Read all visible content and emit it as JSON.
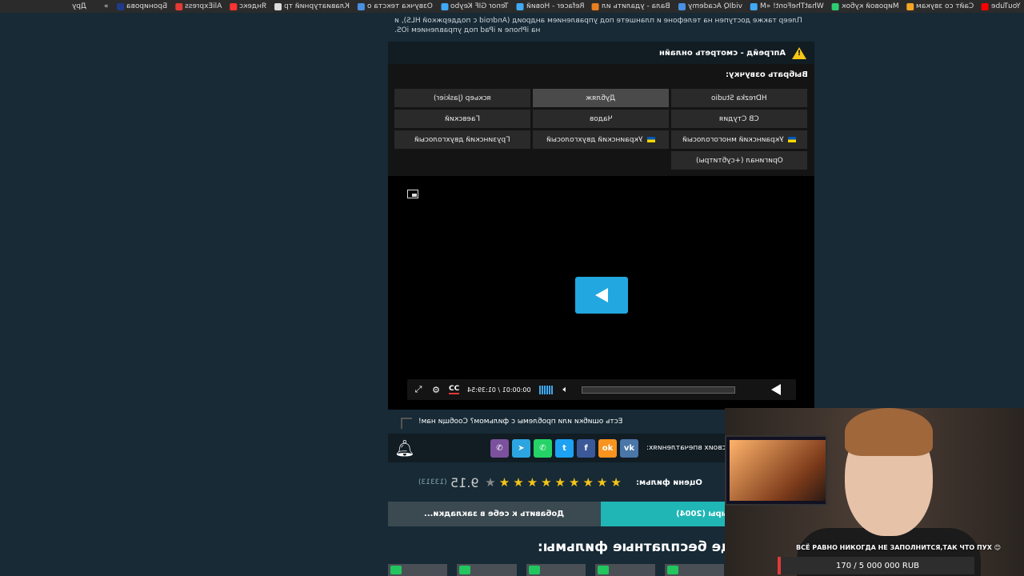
{
  "bookmarks": [
    {
      "label": "YouTube",
      "color": "#ff0000"
    },
    {
      "label": "Сайт со звукам",
      "color": "#f5a623"
    },
    {
      "label": "Мировой кубок",
      "color": "#2ecc71"
    },
    {
      "label": "WhatTheFont! «M",
      "color": "#3fa9f5"
    },
    {
      "label": "vidIQ Academy",
      "color": "#4a90e2"
    },
    {
      "label": "Вала - удалить ил",
      "color": "#e67e22"
    },
    {
      "label": "Refacer - Новий",
      "color": "#3fa9f5"
    },
    {
      "label": "Tenor GIF Keybo",
      "color": "#3fa9f5"
    },
    {
      "label": "Озвучка текста о",
      "color": "#4a90e2"
    },
    {
      "label": "Клавиатурний тр",
      "color": "#dddddd"
    },
    {
      "label": "Яндекс",
      "color": "#ff3333"
    },
    {
      "label": "AliExpress",
      "color": "#e53935"
    },
    {
      "label": "Бронирова",
      "color": "#1e3a8a"
    },
    {
      "label": "»",
      "color": "#2b2b2b"
    },
    {
      "label": "Дру",
      "color": "#2b2b2b"
    }
  ],
  "notice": "Плеер также доступен на телефоне и планшете под управлением андроид (Android с поддержкой HLS), и на iPhone и iPad под управлением iOS.",
  "title": "Апгрейд - смотреть онлайн",
  "voice": {
    "heading": "Выбрать озвучку:",
    "options": [
      {
        "label": "HDrezka Studio",
        "flag": false,
        "active": false
      },
      {
        "label": "Дубляж",
        "flag": false,
        "active": true
      },
      {
        "label": "яскьер (Jaskier)",
        "flag": false,
        "active": false
      },
      {
        "label": "СВ Студия",
        "flag": false,
        "active": false
      },
      {
        "label": "Чадов",
        "flag": false,
        "active": false
      },
      {
        "label": "Гаевский",
        "flag": false,
        "active": false
      },
      {
        "label": "Украинский многоголосый",
        "flag": true,
        "active": false
      },
      {
        "label": "Украинский двухголосый",
        "flag": true,
        "active": false
      },
      {
        "label": "Грузинский двухголосый",
        "flag": false,
        "active": false
      },
      {
        "label": "Оригинал (+субтитры)",
        "flag": false,
        "active": false
      }
    ]
  },
  "player": {
    "time": "00:00:01 / 01:39:54",
    "cc_label": "CC",
    "volume_bars": 6
  },
  "error_text": "Есть ошибки или проблемы с фильмом? Сообщи нам!",
  "share": {
    "label": "своих впечатлениях:",
    "buttons": [
      {
        "name": "viber",
        "glyph": "✆",
        "color": "#7b519d"
      },
      {
        "name": "telegram",
        "glyph": "➤",
        "color": "#2ca5e0"
      },
      {
        "name": "whatsapp",
        "glyph": "✆",
        "color": "#25d366"
      },
      {
        "name": "twitter",
        "glyph": "t",
        "color": "#1da1f2"
      },
      {
        "name": "facebook",
        "glyph": "f",
        "color": "#3b5998"
      },
      {
        "name": "odnoklassniki",
        "glyph": "ok",
        "color": "#f7931e"
      },
      {
        "name": "vk",
        "glyph": "vk",
        "color": "#4a76a8"
      }
    ]
  },
  "rating": {
    "label": "Оцени фильм:",
    "score": "9.15",
    "votes": "(13313)",
    "stars_filled": 9,
    "stars_total": 10
  },
  "actions": {
    "add_bookmark": "Добавить к себе в закладки...",
    "watched": "ыры (2004)"
  },
  "more_title": "ще бесплатные фильмы:",
  "stream": {
    "donate_text": "ВСЁ РАВНО НИКОГДА НЕ ЗАПОЛНИТСЯ,ТАК ЧТО ПУХ 😊",
    "donate_progress": "170 / 5 000 000 RUB"
  }
}
